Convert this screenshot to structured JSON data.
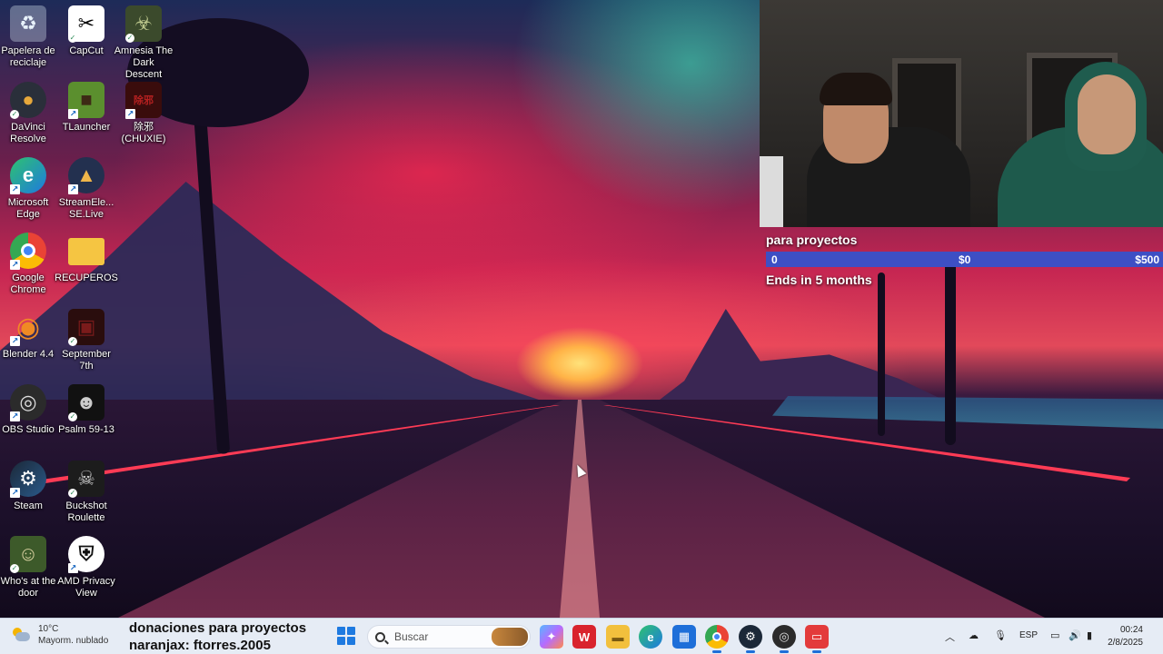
{
  "desktop": {
    "icons": [
      {
        "label": "Papelera de\nreciclaje",
        "icon": "recycle-bin-icon"
      },
      {
        "label": "CapCut",
        "icon": "capcut-icon"
      },
      {
        "label": "Amnesia The\nDark Descent",
        "icon": "amnesia-icon"
      },
      {
        "label": "DaVinci\nResolve",
        "icon": "davinci-resolve-icon"
      },
      {
        "label": "TLauncher",
        "icon": "tlauncher-icon"
      },
      {
        "label": "除邪(CHUXIE)",
        "icon": "chuxie-icon"
      },
      {
        "label": "Microsoft\nEdge",
        "icon": "edge-icon"
      },
      {
        "label": "StreamEle...\nSE.Live",
        "icon": "streamelements-icon"
      },
      {
        "label": "Google\nChrome",
        "icon": "chrome-icon"
      },
      {
        "label": "RECUPEROS",
        "icon": "folder-icon"
      },
      {
        "label": "Blender 4.4",
        "icon": "blender-icon"
      },
      {
        "label": "September\n7th",
        "icon": "september-7th-icon"
      },
      {
        "label": "OBS Studio",
        "icon": "obs-icon"
      },
      {
        "label": "Psalm 59-13",
        "icon": "psalm-icon"
      },
      {
        "label": "Steam",
        "icon": "steam-icon"
      },
      {
        "label": "Buckshot\nRoulette",
        "icon": "buckshot-roulette-icon"
      },
      {
        "label": "Who's at the\ndoor",
        "icon": "whos-at-the-door-icon"
      },
      {
        "label": "AMD Privacy\nView",
        "icon": "amd-privacy-view-icon"
      }
    ]
  },
  "goal": {
    "title": "para proyectos",
    "current": "0",
    "start": "$0",
    "target": "$500",
    "progress_fraction": 0,
    "ends": "Ends in 5 months"
  },
  "taskbar": {
    "weather_temp": "10°C",
    "weather_desc": "Mayorm. nublado",
    "ticker_line1": "donaciones para proyectos",
    "ticker_line2": "naranjax: ftorres.2005",
    "search_placeholder": "Buscar",
    "apps": [
      "copilot-icon",
      "wps-icon",
      "file-explorer-icon",
      "edge-icon",
      "microsoft-store-icon",
      "chrome-icon",
      "steam-icon",
      "obs-icon",
      "capture-icon"
    ],
    "tray_lang": "ESP",
    "time": "00:24",
    "date": "2/8/2025"
  },
  "colors": {
    "goal_bar": "#3d4fc4",
    "taskbar_bg": "#e6ecf5",
    "accent": "#1e7ae0"
  }
}
